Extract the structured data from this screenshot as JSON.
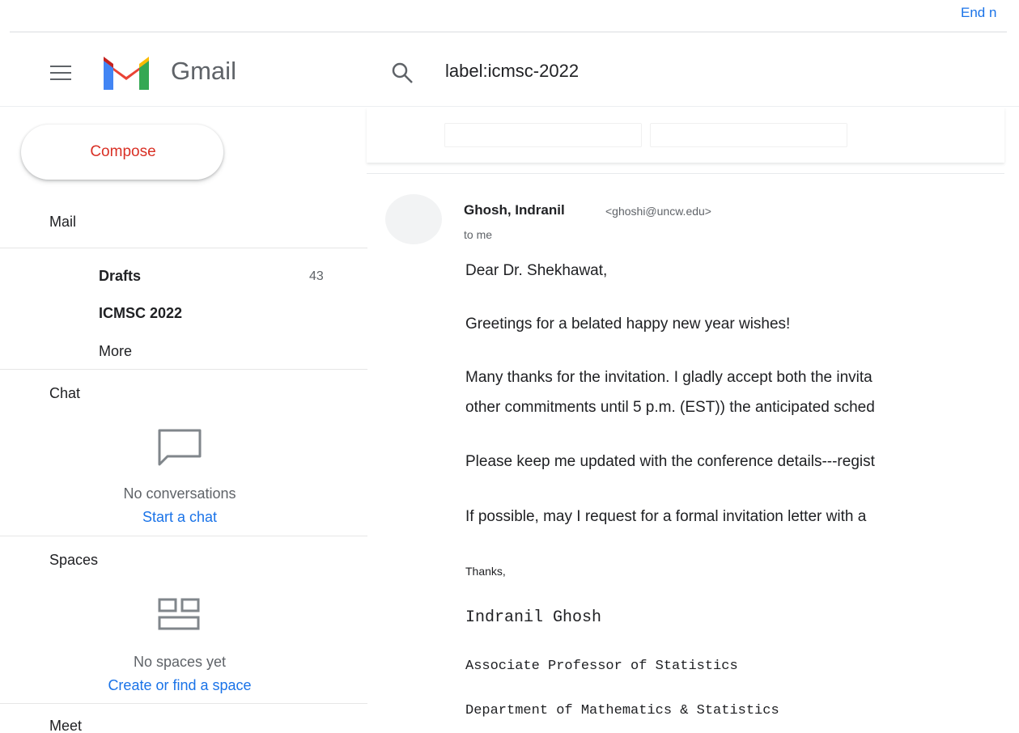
{
  "top": {
    "link": "End n"
  },
  "header": {
    "app_name": "Gmail",
    "search_value": "label:icmsc-2022"
  },
  "sidebar": {
    "compose": "Compose",
    "mail_label": "Mail",
    "items": [
      {
        "label": "Drafts",
        "count": "43"
      },
      {
        "label": "ICMSC 2022"
      },
      {
        "label": "More"
      }
    ],
    "chat": {
      "label": "Chat",
      "empty": "No conversations",
      "link": "Start a chat"
    },
    "spaces": {
      "label": "Spaces",
      "empty": "No spaces yet",
      "link": "Create or find a space"
    },
    "meet_label": "Meet"
  },
  "message": {
    "sender_name": "Ghosh, Indranil",
    "sender_email": "<ghoshi@uncw.edu>",
    "to": "to me",
    "lines": [
      "Dear Dr. Shekhawat,",
      "Greetings for a belated happy new year wishes!",
      "Many thanks for the invitation. I gladly accept both the invita",
      "other commitments until 5 p.m. (EST)) the anticipated sched",
      "Please keep me updated with the conference details---regist",
      "If possible, may I request for a formal invitation letter with a"
    ],
    "thanks": "Thanks,",
    "signature": [
      "Indranil Ghosh",
      "Associate Professor of Statistics",
      "Department of Mathematics & Statistics"
    ]
  },
  "colors": {
    "accent_blue": "#1a73e8",
    "compose_red": "#d93025",
    "gmail_red": "#ea4335"
  },
  "icons": [
    "menu-icon",
    "gmail-logo",
    "search-icon",
    "chat-bubble-icon",
    "spaces-grid-icon",
    "avatar-placeholder"
  ]
}
